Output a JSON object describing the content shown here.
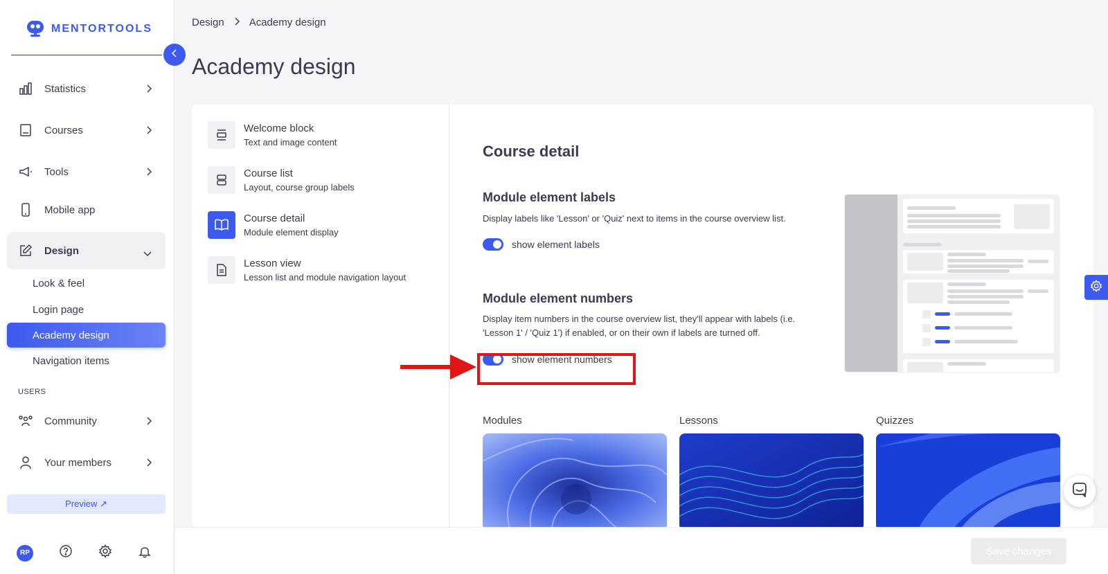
{
  "brand": {
    "name": "MENTORTOOLS",
    "accent": "#3d5aee"
  },
  "sidebar": {
    "items": [
      {
        "label": "Statistics",
        "icon": "bar-chart-icon"
      },
      {
        "label": "Courses",
        "icon": "book-icon"
      },
      {
        "label": "Tools",
        "icon": "megaphone-icon"
      },
      {
        "label": "Mobile app",
        "icon": "mobile-icon"
      },
      {
        "label": "Design",
        "icon": "edit-icon"
      }
    ],
    "design_sub": [
      {
        "label": "Look & feel"
      },
      {
        "label": "Login page"
      },
      {
        "label": "Academy design"
      },
      {
        "label": "Navigation items"
      }
    ],
    "users_section": "USERS",
    "users_items": [
      {
        "label": "Community",
        "icon": "community-icon"
      },
      {
        "label": "Your members",
        "icon": "user-icon"
      }
    ],
    "preview_label": "Preview ↗",
    "avatar_initials": "RP"
  },
  "breadcrumb": {
    "parent": "Design",
    "current": "Academy design"
  },
  "page_title": "Academy design",
  "settings_menu": [
    {
      "title": "Welcome block",
      "subtitle": "Text and image content",
      "icon": "align-center-icon"
    },
    {
      "title": "Course list",
      "subtitle": "Layout, course group labels",
      "icon": "list-layout-icon"
    },
    {
      "title": "Course detail",
      "subtitle": "Module element display",
      "icon": "open-book-icon"
    },
    {
      "title": "Lesson view",
      "subtitle": "Lesson list and module navigation layout",
      "icon": "document-icon"
    }
  ],
  "course_detail": {
    "title": "Course detail",
    "labels_heading": "Module element labels",
    "labels_desc": "Display labels like 'Lesson' or 'Quiz' next to items in the course overview list.",
    "labels_toggle": "show element labels",
    "labels_toggle_on": true,
    "numbers_heading": "Module element numbers",
    "numbers_desc": "Display item numbers in the course overview list, they'll appear with labels (i.e. 'Lesson 1' / 'Quiz 1') if enabled, or on their own if labels are turned off.",
    "numbers_toggle": "show element numbers",
    "numbers_toggle_on": true
  },
  "image_sections": [
    {
      "label": "Modules"
    },
    {
      "label": "Lessons"
    },
    {
      "label": "Quizzes"
    }
  ],
  "footer": {
    "save_label": "Save changes"
  }
}
